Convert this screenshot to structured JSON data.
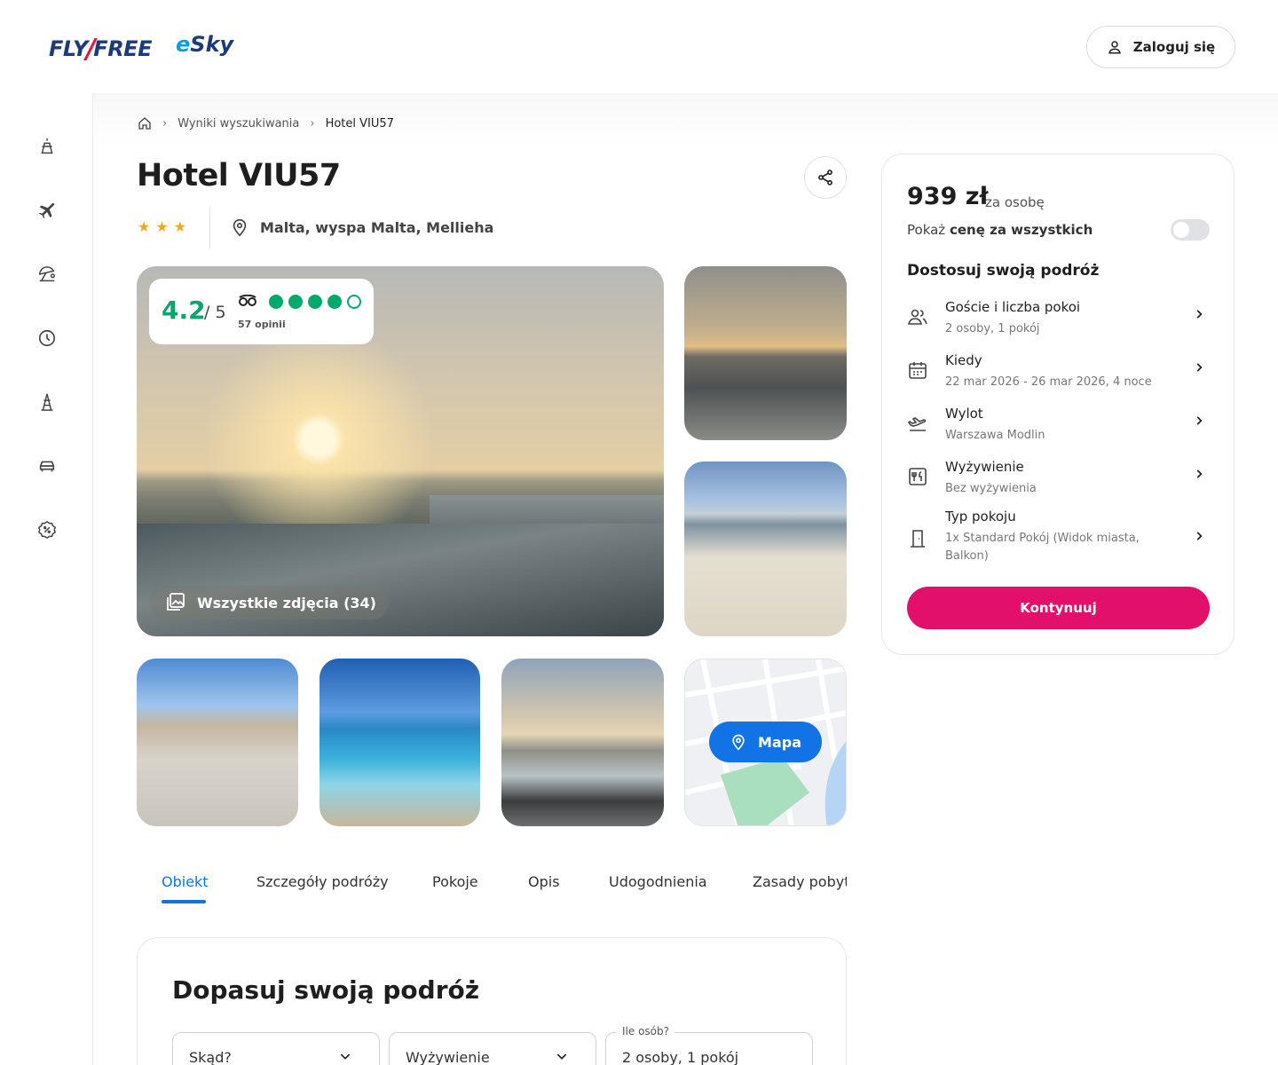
{
  "header": {
    "logo_flyfree_left": "FLY",
    "logo_flyfree_right": "FREE",
    "logo_esky_e": "e",
    "logo_esky_rest": "Sky",
    "login_label": "Zaloguj się"
  },
  "sidebar": {
    "icons": [
      "beach-vacation-icon",
      "plane-icon",
      "umbrella-beach-icon",
      "last-minute-clock-icon",
      "city-break-icon",
      "car-icon",
      "discount-icon"
    ]
  },
  "breadcrumb": {
    "home_icon": "home-icon",
    "results": "Wyniki wyszukiwania",
    "current": "Hotel VIU57",
    "separator": "›"
  },
  "hotel": {
    "name": "Hotel VIU57",
    "stars": 3,
    "star_glyph": "★",
    "location": "Malta, wyspa Malta, Mellieha"
  },
  "rating": {
    "score": "4.2",
    "of": "/ 5",
    "bubbles_filled": 4,
    "bubbles_total": 5,
    "reviews": "57 opinii",
    "provider_icon": "tripadvisor-icon"
  },
  "gallery": {
    "all_photos_label": "Wszystkie zdjęcia (34)",
    "map_label": "Mapa"
  },
  "tabs": [
    {
      "label": "Obiekt",
      "active": true
    },
    {
      "label": "Szczegóły podróży",
      "active": false
    },
    {
      "label": "Pokoje",
      "active": false
    },
    {
      "label": "Opis",
      "active": false
    },
    {
      "label": "Udogodnienia",
      "active": false
    },
    {
      "label": "Zasady pobytu",
      "active": false
    }
  ],
  "adjust": {
    "title": "Dopasuj swoją podróż",
    "from_placeholder": "Skąd?",
    "board_placeholder": "Wyżywienie",
    "people_label": "Ile osób?",
    "people_value": "2 osoby, 1 pokój"
  },
  "price_card": {
    "price": "939 zł",
    "per": "za osobę",
    "show_all_prefix": "Pokaż ",
    "show_all_bold": "cenę za wszystkich",
    "toggle_on": false,
    "section_title": "Dostosuj swoją podróż",
    "options": [
      {
        "label": "Goście i liczba pokoi",
        "value": "2 osoby, 1 pokój",
        "icon": "guests-icon"
      },
      {
        "label": "Kiedy",
        "value": "22 mar 2026 - 26 mar 2026, 4 noce",
        "icon": "calendar-icon"
      },
      {
        "label": "Wylot",
        "value": "Warszawa Modlin",
        "icon": "departure-icon"
      },
      {
        "label": "Wyżywienie",
        "value": "Bez wyżywienia",
        "icon": "meal-icon"
      },
      {
        "label": "Typ pokoju",
        "value": "1x Standard Pokój (Widok miasta, Balkon)",
        "icon": "room-door-icon"
      }
    ],
    "continue_label": "Kontynuuj",
    "accent": "#e2106b"
  },
  "colors": {
    "primary_blue": "#1173e6",
    "rating_green": "#10a36b",
    "star": "#f5a623"
  }
}
